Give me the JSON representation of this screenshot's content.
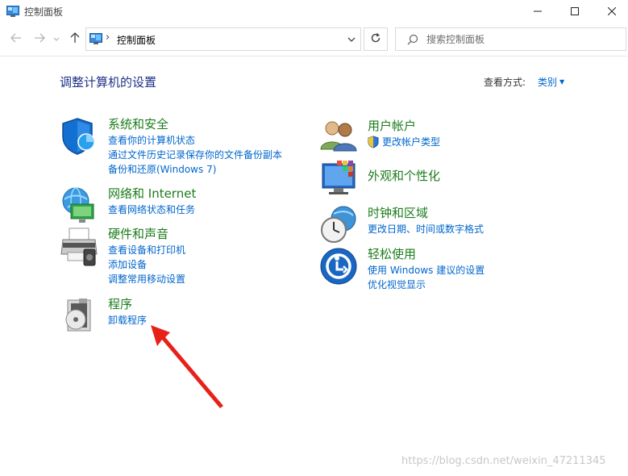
{
  "window": {
    "title": "控制面板",
    "controls": {
      "minimize": "minimize-icon",
      "maximize": "maximize-icon",
      "close": "close-icon"
    }
  },
  "address_bar": {
    "path": "控制面板",
    "separator": "›",
    "search_placeholder": "搜索控制面板"
  },
  "content": {
    "title": "调整计算机的设置",
    "view_by_label": "查看方式:",
    "view_by_value": "类别"
  },
  "categories": {
    "system_security": {
      "title": "系统和安全",
      "icon": "shield-icon",
      "links": [
        "查看你的计算机状态",
        "通过文件历史记录保存你的文件备份副本",
        "备份和还原(Windows 7)"
      ]
    },
    "network": {
      "title": "网络和 Internet",
      "icon": "network-globe-icon",
      "links": [
        "查看网络状态和任务"
      ]
    },
    "hardware_sound": {
      "title": "硬件和声音",
      "icon": "printer-icon",
      "links": [
        "查看设备和打印机",
        "添加设备",
        "调整常用移动设置"
      ]
    },
    "programs": {
      "title": "程序",
      "icon": "programs-disc-icon",
      "links": [
        "卸载程序"
      ]
    },
    "user_accounts": {
      "title": "用户帐户",
      "icon": "users-icon",
      "links": [
        "更改帐户类型"
      ]
    },
    "appearance": {
      "title": "外观和个性化",
      "icon": "monitor-palette-icon",
      "links": []
    },
    "clock_region": {
      "title": "时钟和区域",
      "icon": "clock-globe-icon",
      "links": [
        "更改日期、时间或数字格式"
      ]
    },
    "ease_of_access": {
      "title": "轻松使用",
      "icon": "ease-of-access-icon",
      "links": [
        "使用 Windows 建议的设置",
        "优化视觉显示"
      ]
    }
  },
  "annotation": {
    "color": "#e8201a"
  },
  "watermark": "https://blog.csdn.net/weixin_47211345",
  "colors": {
    "link": "#0066cc",
    "category_title": "#1c7c1c",
    "page_title": "#1e3287"
  }
}
